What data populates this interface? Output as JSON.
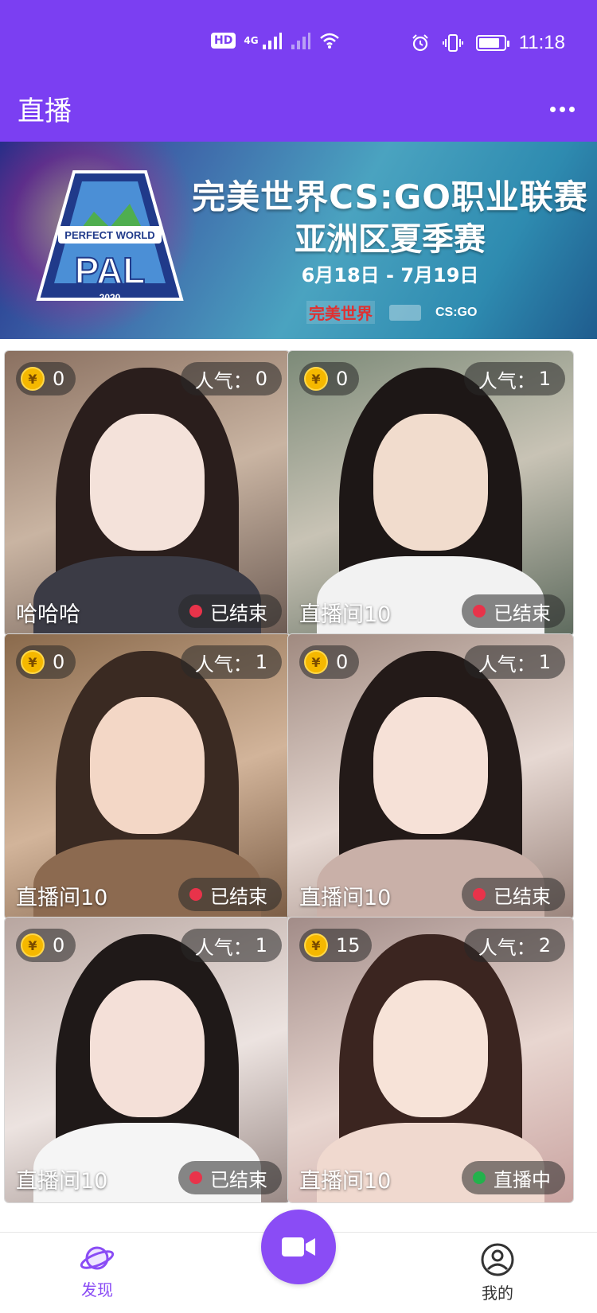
{
  "status_bar": {
    "network_badge": "HD",
    "network_gen": "4G",
    "time": "11:18",
    "battery_level": 0.85
  },
  "app_bar": {
    "title": "直播",
    "more_icon": "more-dots-icon"
  },
  "banner": {
    "title": "完美世界CS:GO职业联赛",
    "subtitle": "亚洲区夏季赛",
    "dates": "6月18日 - 7月19日",
    "logo_text": "PAL",
    "logo_caption": "PERFECT WORLD",
    "logo_year": "2020",
    "sponsor_1": "完美世界",
    "sponsor_3": "CS:GO",
    "slide_count": 2,
    "active_slide": 0
  },
  "rooms": [
    {
      "coins": "0",
      "popularity_label": "人气：",
      "popularity": "0",
      "name": "哈哈哈",
      "status": "已结束",
      "status_color": "#e8334a"
    },
    {
      "coins": "0",
      "popularity_label": "人气：",
      "popularity": "1",
      "name": "直播间10",
      "status": "已结束",
      "status_color": "#e8334a"
    },
    {
      "coins": "0",
      "popularity_label": "人气：",
      "popularity": "1",
      "name": "直播间10",
      "status": "已结束",
      "status_color": "#e8334a"
    },
    {
      "coins": "0",
      "popularity_label": "人气：",
      "popularity": "1",
      "name": "直播间10",
      "status": "已结束",
      "status_color": "#e8334a"
    },
    {
      "coins": "0",
      "popularity_label": "人气：",
      "popularity": "1",
      "name": "直播间10",
      "status": "已结束",
      "status_color": "#e8334a"
    },
    {
      "coins": "15",
      "popularity_label": "人气：",
      "popularity": "2",
      "name": "直播间10",
      "status": "直播中",
      "status_color": "#22b24c"
    }
  ],
  "coin_symbol": "¥",
  "tab_bar": {
    "tabs": [
      {
        "label": "发现",
        "icon": "planet-icon",
        "active": true
      },
      {
        "label": "我的",
        "icon": "user-icon",
        "active": false
      }
    ],
    "fab_icon": "video-camera-icon"
  },
  "colors": {
    "primary": "#7b3ff2",
    "fab": "#8a4cf5",
    "tab_active": "#8a4cf5",
    "tab_inactive": "#333333",
    "ended": "#e8334a",
    "live": "#22b24c",
    "coin": "#f5b800"
  }
}
